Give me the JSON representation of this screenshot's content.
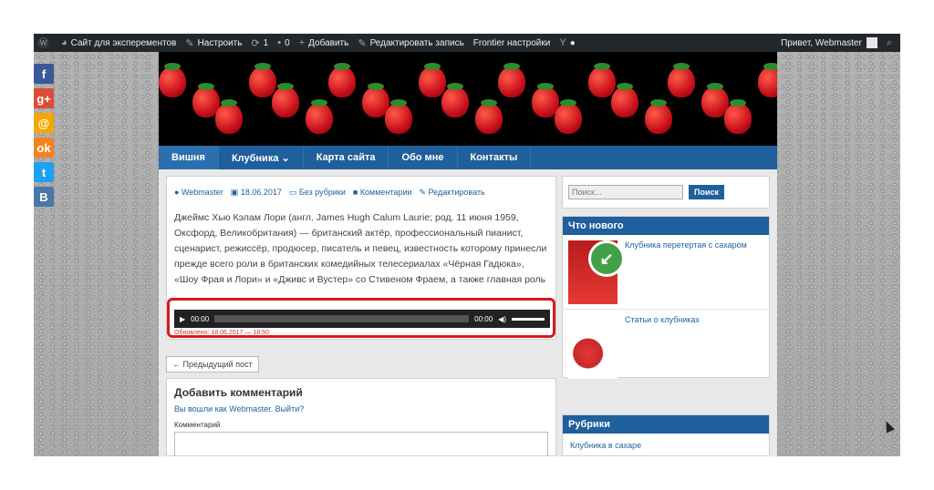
{
  "admin_bar": {
    "site_name": "Сайт для эксперементов",
    "customize": "Настроить",
    "updates_count": "1",
    "comments_count": "0",
    "add_new": "Добавить",
    "edit_post": "Редактировать запись",
    "frontier": "Frontier настройки",
    "greeting": "Привет, Webmaster"
  },
  "share": [
    {
      "icon": "facebook-icon",
      "glyph": "f",
      "color": "#3b5998"
    },
    {
      "icon": "googleplus-icon",
      "glyph": "g+",
      "color": "#dd4b39"
    },
    {
      "icon": "mailru-icon",
      "glyph": "@",
      "color": "#f7a600"
    },
    {
      "icon": "odnoklassniki-icon",
      "glyph": "ok",
      "color": "#f58220"
    },
    {
      "icon": "twitter-icon",
      "glyph": "t",
      "color": "#1da1f2"
    },
    {
      "icon": "vk-icon",
      "glyph": "B",
      "color": "#4a76a8"
    }
  ],
  "nav": [
    "Вишня",
    "Клубника ⌄",
    "Карта сайта",
    "Обо мне",
    "Контакты"
  ],
  "post": {
    "author": "Webmaster",
    "date": "18.06.2017",
    "category": "Без рубрики",
    "comments": "Комментарии",
    "edit": "Редактировать",
    "excerpt": "Джеймс Хью Кэлам Лори (англ. James Hugh Calum Laurie; род. 11 июня 1959, Оксфорд, Великобритания) — британский актёр, профессиональный пианист, сценарист, режиссёр, продюсер, писатель и певец, известность которому принесли прежде всего роли в британских комедийных телесериалах «Чёрная Гадюка», «Шоу Фрая и Лори» и «Дживс и Вустер» со Стивеном Фраем, а также главная роль в американском телесериале «Доктор Хаус».",
    "player": {
      "time_start": "00:00",
      "time_end": "00:00"
    },
    "published": "Обновлено: 18.06.2017 — 18:50"
  },
  "prev_post": "← Предыдущий пост",
  "comment_form": {
    "title": "Добавить комментарий",
    "logged_in": "Вы вошли как Webmaster. Выйти?",
    "label": "Комментарий"
  },
  "sidebar": {
    "search_placeholder": "Поиск...",
    "search_button": "Поиск",
    "news_title": "Что нового",
    "news": [
      "Клубника перетертая с сахаром",
      "Статьи о клубниках"
    ],
    "categories_title": "Рубрики",
    "categories": [
      "Клубника в сахаре"
    ]
  },
  "colors": {
    "accent": "#1f5f9c",
    "highlight": "#d71920"
  }
}
